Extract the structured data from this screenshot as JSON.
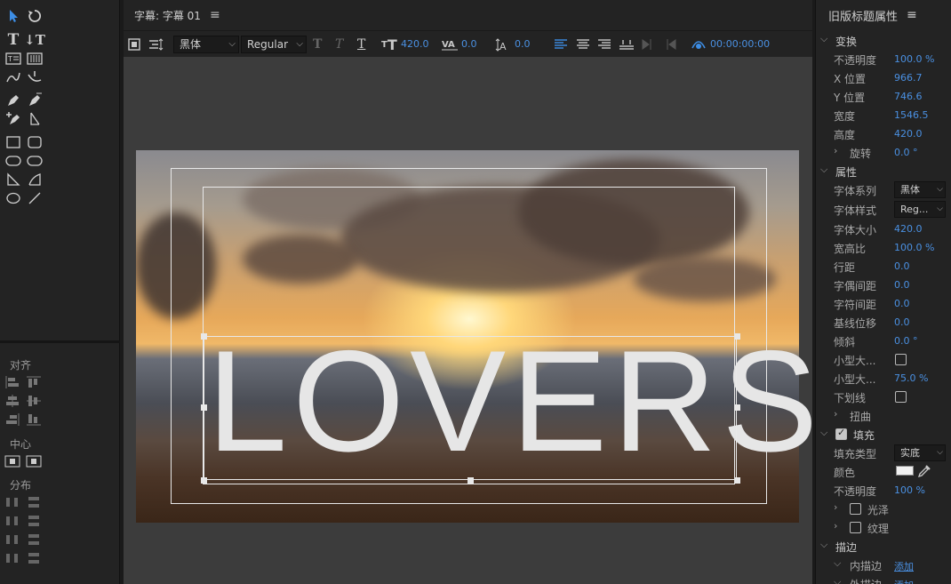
{
  "center": {
    "title": "字幕: 字幕 01",
    "font_family": "黑体",
    "font_style": "Regular",
    "font_size": "420.0",
    "kerning": "0.0",
    "leading": "0.0",
    "timecode": "00:00:00:00",
    "caption_text": "LOVERS"
  },
  "left": {
    "align_label": "对齐",
    "center_label": "中心",
    "distribute_label": "分布"
  },
  "right": {
    "title": "旧版标题属性",
    "transform": {
      "label": "变换",
      "opacity_label": "不透明度",
      "opacity": "100.0 %",
      "x_label": "X 位置",
      "x": "966.7",
      "y_label": "Y 位置",
      "y": "746.6",
      "width_label": "宽度",
      "width": "1546.5",
      "height_label": "高度",
      "height": "420.0",
      "rotation_label": "旋转",
      "rotation": "0.0 °"
    },
    "properties": {
      "label": "属性",
      "font_family_label": "字体系列",
      "font_family": "黑体",
      "font_style_label": "字体样式",
      "font_style": "Reg...",
      "font_size_label": "字体大小",
      "font_size": "420.0",
      "aspect_label": "宽高比",
      "aspect": "100.0 %",
      "leading_label": "行距",
      "leading": "0.0",
      "kerning_label": "字偶间距",
      "kerning": "0.0",
      "tracking_label": "字符间距",
      "tracking": "0.0",
      "baseline_label": "基线位移",
      "baseline": "0.0",
      "slant_label": "倾斜",
      "slant": "0.0 °",
      "smallcaps_label": "小型大...",
      "smallcaps_size_label": "小型大...",
      "smallcaps_size": "75.0 %",
      "underline_label": "下划线",
      "distort_label": "扭曲"
    },
    "fill": {
      "label": "填充",
      "type_label": "填充类型",
      "type": "实底",
      "color_label": "颜色",
      "color": "#f0f0f0",
      "opacity_label": "不透明度",
      "opacity": "100 %",
      "sheen_label": "光泽",
      "texture_label": "纹理"
    },
    "stroke": {
      "label": "描边",
      "inner_label": "内描边",
      "inner_action": "添加",
      "outer_label": "外描边",
      "outer_action": "添加"
    }
  },
  "colors": {
    "accent": "#4a90e2",
    "panel": "#232323",
    "canvas_bg": "#3c3c3c"
  }
}
